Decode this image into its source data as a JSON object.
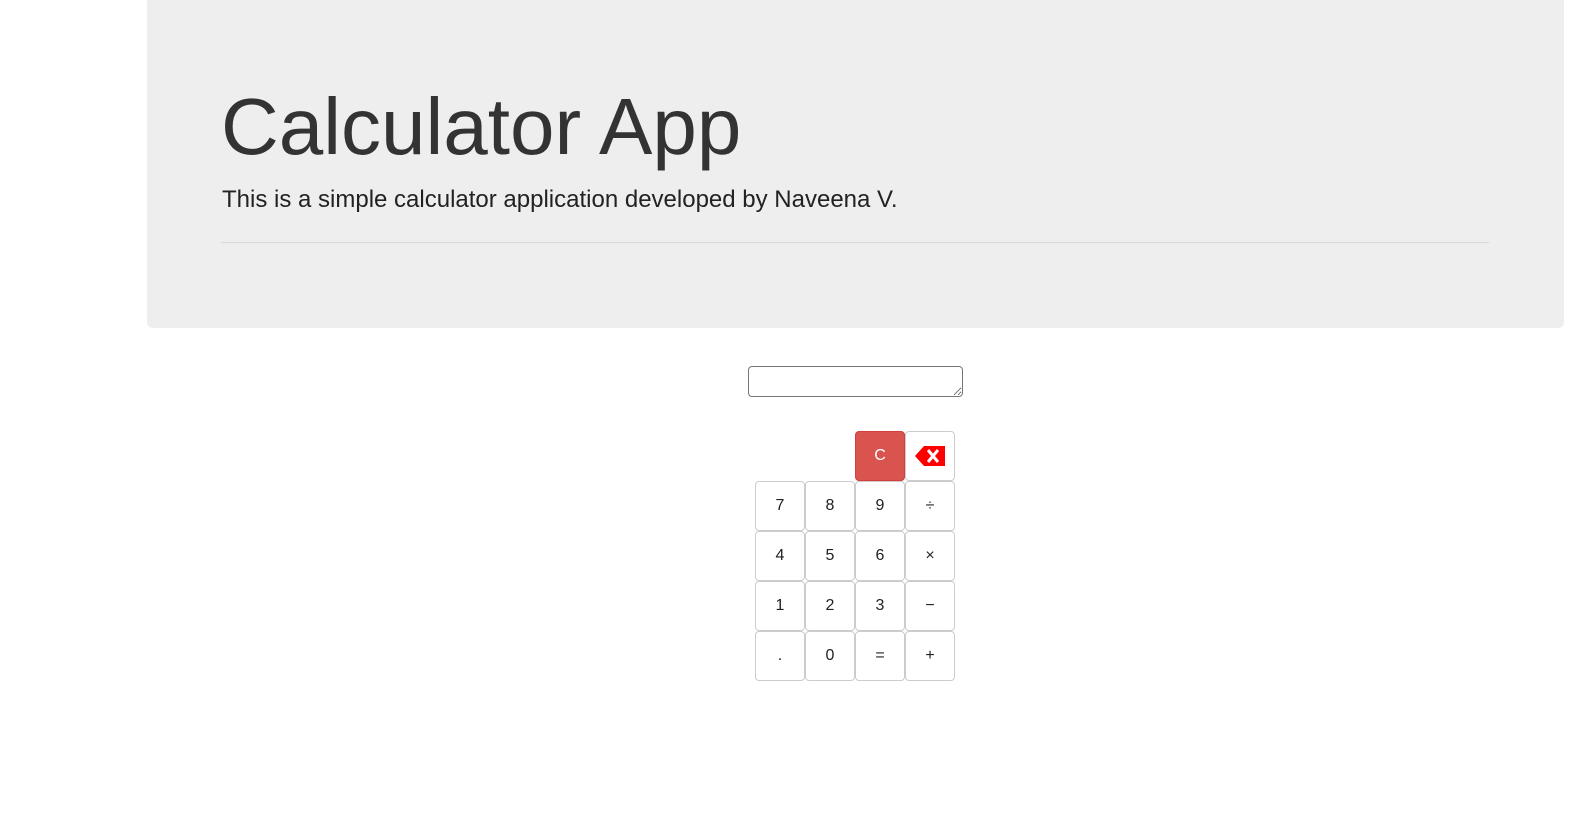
{
  "header": {
    "title": "Calculator App",
    "subtitle": "This is a simple calculator application developed by Naveena V."
  },
  "display": {
    "value": ""
  },
  "keypad": {
    "clear_label": "C",
    "backspace_icon": "backspace-icon",
    "backspace_color": "#ff0000",
    "clear_color": "#d9534f",
    "rows": [
      [
        "7",
        "8",
        "9",
        "÷"
      ],
      [
        "4",
        "5",
        "6",
        "×"
      ],
      [
        "1",
        "2",
        "3",
        "−"
      ],
      [
        ".",
        "0",
        "=",
        "+"
      ]
    ]
  }
}
